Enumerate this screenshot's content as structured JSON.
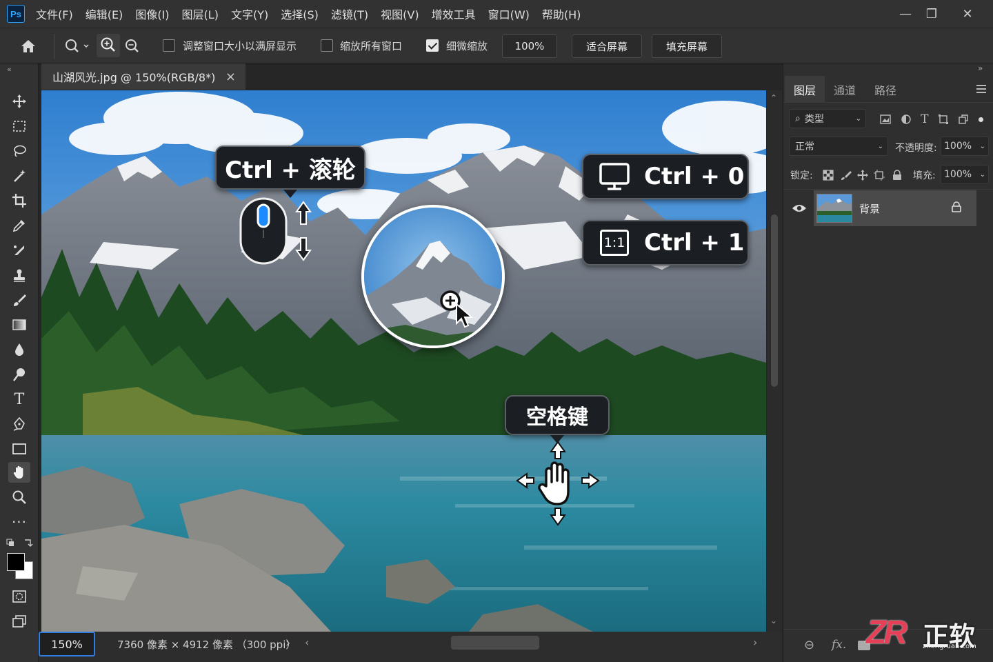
{
  "app": {
    "logo": "Ps"
  },
  "menu": [
    "文件(F)",
    "编辑(E)",
    "图像(I)",
    "图层(L)",
    "文字(Y)",
    "选择(S)",
    "滤镜(T)",
    "视图(V)",
    "增效工具",
    "窗口(W)",
    "帮助(H)"
  ],
  "window_controls": {
    "minimize": "—",
    "restore": "❐",
    "close": "✕"
  },
  "options": {
    "resize_windows_label": "调整窗口大小以满屏显示",
    "resize_windows_checked": false,
    "zoom_all_label": "缩放所有窗口",
    "zoom_all_checked": false,
    "scrubby_label": "细微缩放",
    "scrubby_checked": true,
    "zoom_value": "100%",
    "fit_screen": "适合屏幕",
    "fill_screen": "填充屏幕"
  },
  "document": {
    "tab_title": "山湖风光.jpg @ 150%(RGB/8*)",
    "close": "×"
  },
  "overlays": {
    "wheel_shortcut": "Ctrl + 滚轮",
    "fit_shortcut": "Ctrl + 0",
    "actual_shortcut": "Ctrl + 1",
    "actual_badge": "1:1",
    "pan_key": "空格键"
  },
  "status": {
    "zoom": "150%",
    "dimensions": "7360 像素 × 4912 像素 （300 ppi）",
    "more": "›"
  },
  "panel": {
    "tabs": [
      "图层",
      "通道",
      "路径"
    ],
    "active_tab": 0,
    "filter_label": "类型",
    "blend_mode": "正常",
    "opacity_label": "不透明度:",
    "opacity_value": "100%",
    "lock_label": "锁定:",
    "fill_label": "填充:",
    "fill_value": "100%",
    "layers": [
      {
        "name": "背景",
        "visible": true,
        "locked": true
      }
    ],
    "footer": {
      "link": "⊖",
      "fx": "fx."
    }
  },
  "watermark": {
    "brand": "ZR",
    "name": "正软",
    "url": "zhengruan.com"
  },
  "colors": {
    "accent": "#2f7de1",
    "panel_bg": "#2f2f2f",
    "bar_bg": "#323232"
  }
}
